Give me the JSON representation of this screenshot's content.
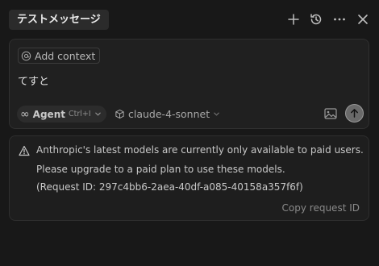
{
  "header": {
    "title": "テストメッセージ",
    "icons": [
      "plus-icon",
      "history-icon",
      "more-icon",
      "close-icon"
    ]
  },
  "composer": {
    "add_context_label": "Add context",
    "input_text": "てすと",
    "mode": {
      "label": "Agent",
      "shortcut": "Ctrl+I"
    },
    "model": "claude-4-sonnet"
  },
  "error": {
    "line1": "Anthropic's latest models are currently only available to paid users.",
    "line2": "Please upgrade to a paid plan to use these models.",
    "line3": "(Request ID: 297c4bb6-2aea-40df-a085-40158a357f6f)",
    "copy_label": "Copy request ID"
  },
  "colors": {
    "background": "#181818",
    "panel": "#202020",
    "warning": "#d7ba7d"
  }
}
